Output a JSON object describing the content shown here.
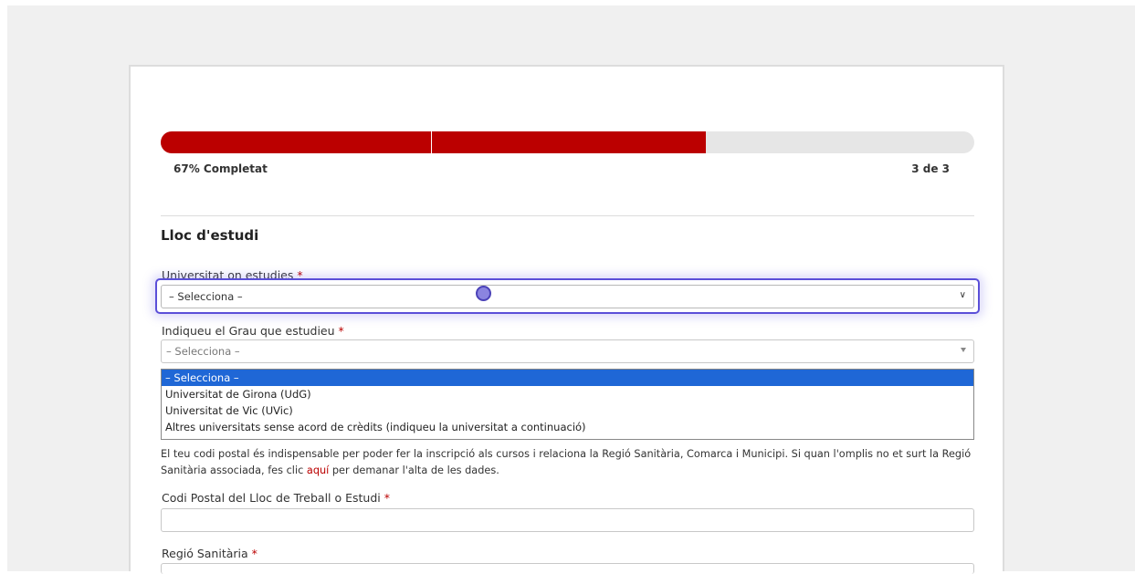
{
  "progress": {
    "percent": 67,
    "label": "67% Completat",
    "step": "3 de 3",
    "fill_color": "#bb0000"
  },
  "section": {
    "title": "Lloc d'estudi"
  },
  "universitat": {
    "label": "Universitat on estudies",
    "required_mark": "*",
    "value": "– Selecciona –",
    "options": [
      "– Selecciona –",
      "Universitat de Girona (UdG)",
      "Universitat de Vic (UVic)",
      "Altres universitats sense acord de crèdits (indiqueu la universitat a continuació)"
    ]
  },
  "grau": {
    "label": "Indiqueu el Grau que estudieu",
    "required_mark": "*",
    "value": "– Selecciona –"
  },
  "info": {
    "text_before": "El teu codi postal és indispensable per poder fer la inscripció als cursos i relaciona la Regió Sanitària, Comarca i Municipi. Si quan l'omplis no et surt la Regió Sanitària associada, fes clic ",
    "link": "aquí",
    "text_after": " per demanar l'alta de les dades."
  },
  "codi_postal": {
    "label": "Codi Postal del Lloc de Treball o Estudi",
    "required_mark": "*",
    "value": ""
  },
  "regio": {
    "label": "Regió Sanitària",
    "required_mark": "*"
  }
}
